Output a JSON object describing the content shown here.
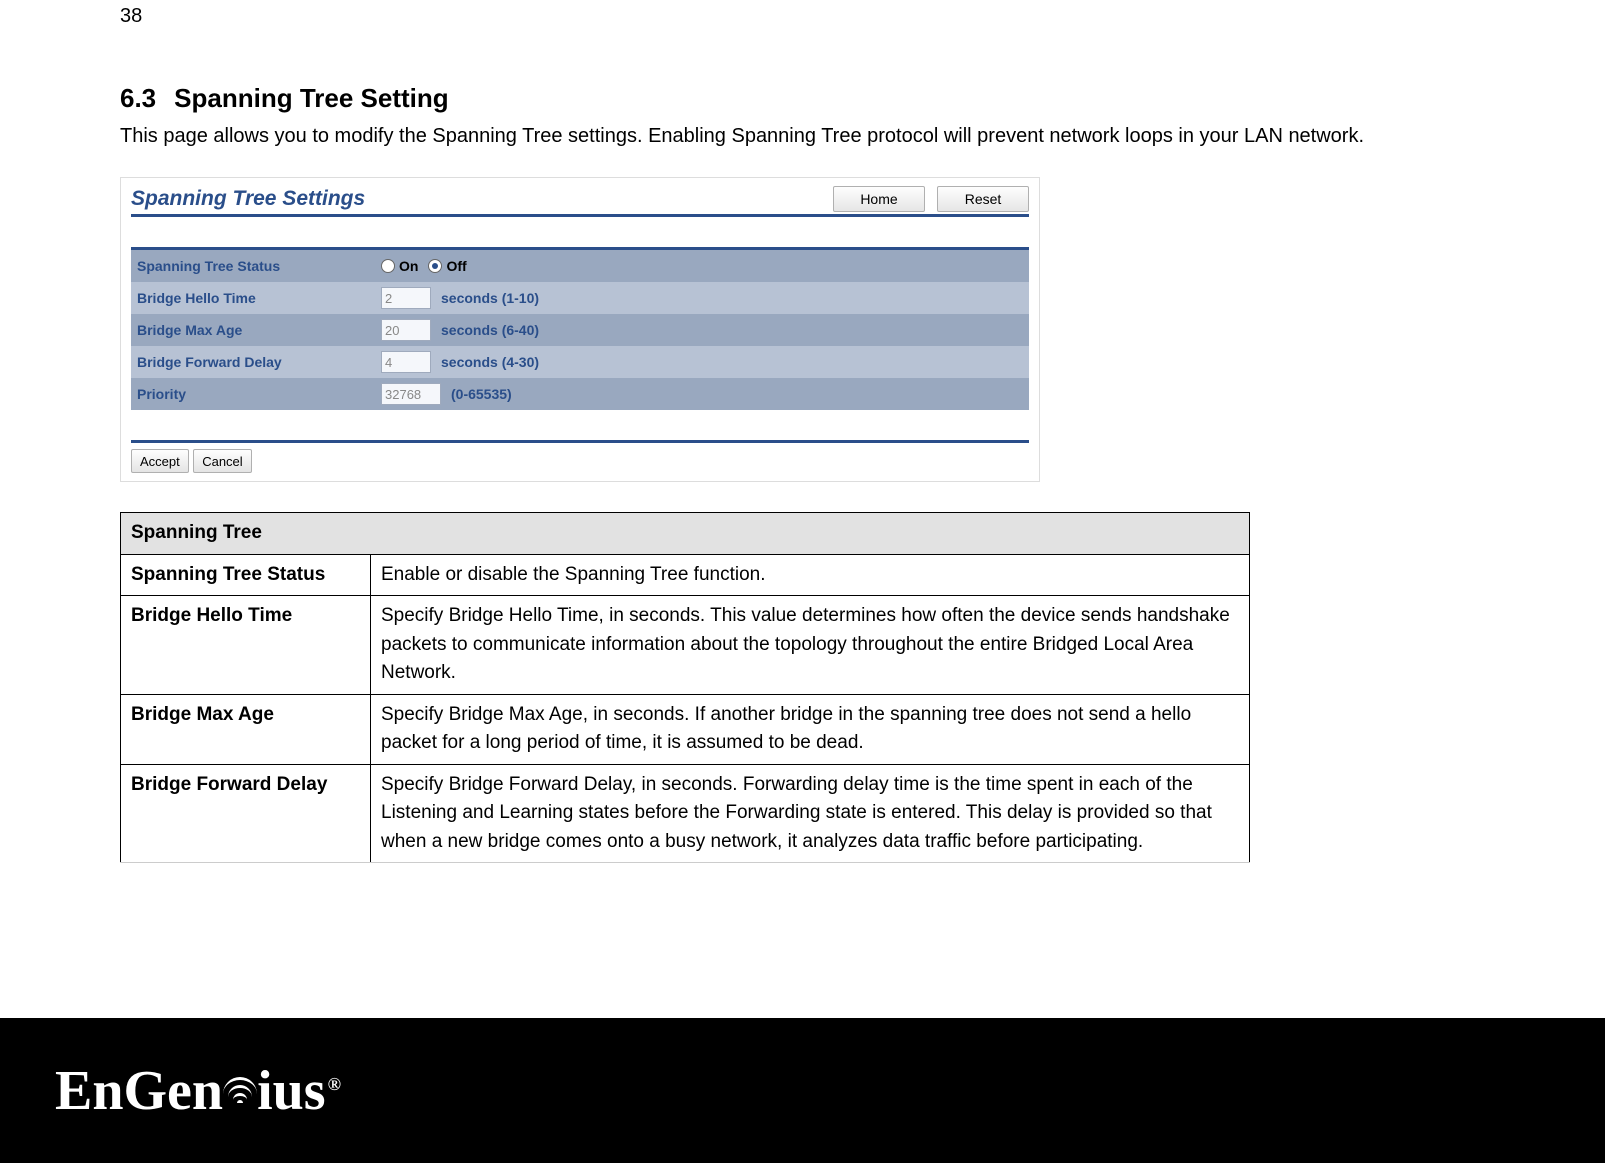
{
  "page_number": "38",
  "section": {
    "number": "6.3",
    "title": "Spanning Tree Setting"
  },
  "intro": "This page allows you to modify the Spanning Tree settings. Enabling Spanning Tree protocol will prevent network loops in your LAN network.",
  "ui": {
    "header": "Spanning Tree Settings",
    "buttons": {
      "home": "Home",
      "reset": "Reset"
    },
    "fields": {
      "status": {
        "label": "Spanning Tree Status",
        "on": "On",
        "off": "Off",
        "selected": "off"
      },
      "hello": {
        "label": "Bridge Hello Time",
        "value": "2",
        "unit": "seconds (1-10)"
      },
      "maxage": {
        "label": "Bridge Max Age",
        "value": "20",
        "unit": "seconds (6-40)"
      },
      "fwd": {
        "label": "Bridge Forward Delay",
        "value": "4",
        "unit": "seconds (4-30)"
      },
      "prio": {
        "label": "Priority",
        "value": "32768",
        "unit": "(0-65535)"
      }
    },
    "actions": {
      "accept": "Accept",
      "cancel": "Cancel"
    }
  },
  "desc_table": {
    "header": "Spanning Tree",
    "rows": [
      {
        "param": "Spanning Tree Status",
        "desc": "Enable or disable the Spanning Tree function."
      },
      {
        "param": "Bridge Hello Time",
        "desc": "Specify Bridge Hello Time, in seconds. This value determines how often the device sends handshake packets to communicate information about the topology throughout the entire Bridged Local Area Network."
      },
      {
        "param": "Bridge Max Age",
        "desc": "Specify Bridge Max Age, in seconds. If another bridge in the spanning tree does not send a hello packet for a long period of time, it is assumed to be dead."
      },
      {
        "param": "Bridge Forward Delay",
        "desc": "Specify Bridge Forward Delay, in seconds. Forwarding delay time is the time spent in each of the Listening and Learning states before the Forwarding state is entered. This delay is provided so that when a new bridge comes onto a busy network, it analyzes data traffic before participating."
      }
    ]
  },
  "brand": {
    "name": "EnGenius",
    "mark": "®"
  }
}
